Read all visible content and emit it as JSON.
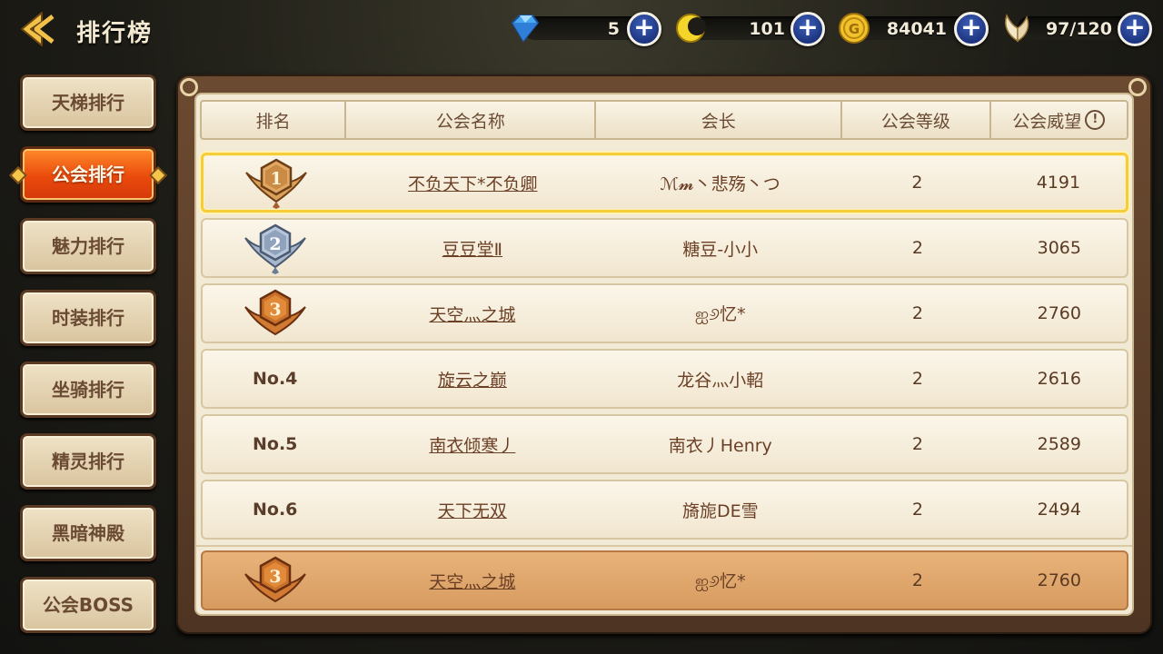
{
  "header": {
    "title": "排行榜",
    "resources": [
      {
        "name": "diamond",
        "icon": "diamond-icon",
        "value": "5"
      },
      {
        "name": "moon",
        "icon": "crescent-moon-icon",
        "value": "101"
      },
      {
        "name": "gold",
        "icon": "gold-coin-icon",
        "value": "84041"
      },
      {
        "name": "stamina",
        "icon": "wings-icon",
        "value": "97/120"
      }
    ]
  },
  "nav": {
    "items": [
      {
        "label": "天梯排行"
      },
      {
        "label": "公会排行",
        "active": true
      },
      {
        "label": "魅力排行"
      },
      {
        "label": "时装排行"
      },
      {
        "label": "坐骑排行"
      },
      {
        "label": "精灵排行"
      },
      {
        "label": "黑暗神殿"
      },
      {
        "label": "公会BOSS"
      }
    ]
  },
  "table": {
    "columns": [
      "排名",
      "公会名称",
      "会长",
      "公会等级",
      "公会威望"
    ],
    "rows": [
      {
        "rank": "1",
        "name": "不负天下*不负卿",
        "leader": "ℳ𝓶丶悲殇丶つ",
        "level": "2",
        "prestige": "4191"
      },
      {
        "rank": "2",
        "name": "豆豆堂Ⅱ",
        "leader": "糖豆-小小",
        "level": "2",
        "prestige": "3065"
      },
      {
        "rank": "3",
        "name": "天空灬之城",
        "leader": "ஐ୬忆*",
        "level": "2",
        "prestige": "2760"
      },
      {
        "rank": "No.4",
        "name": "旋云之巅",
        "leader": "龙谷灬小軺",
        "level": "2",
        "prestige": "2616"
      },
      {
        "rank": "No.5",
        "name": "南衣倾寒丿",
        "leader": "南衣丿Henry",
        "level": "2",
        "prestige": "2589"
      },
      {
        "rank": "No.6",
        "name": "天下无双",
        "leader": "旖旎DE雪",
        "level": "2",
        "prestige": "2494"
      }
    ],
    "my_guild": {
      "rank": "3",
      "name": "天空灬之城",
      "leader": "ஐ୬忆*",
      "level": "2",
      "prestige": "2760"
    }
  },
  "colors": {
    "active_nav": "#ea4a0c",
    "gold_medal": "#d9a25a",
    "silver_medal": "#8fa3bd",
    "bronze_medal": "#c9702a",
    "highlight_border": "#f6cc3a",
    "my_row": "#dca468"
  }
}
